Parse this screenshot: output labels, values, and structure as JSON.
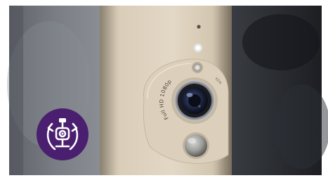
{
  "photo": {
    "subject": "camera-device",
    "lens_print": "Full HD 1080p",
    "side_print": "KEM"
  },
  "badge": {
    "icon": "camera-rotate-icon",
    "color": "#4a1f6f"
  },
  "colors": {
    "device_body": "#d8cbb5",
    "background_left": "#6d7177",
    "background_right": "#26292e"
  }
}
